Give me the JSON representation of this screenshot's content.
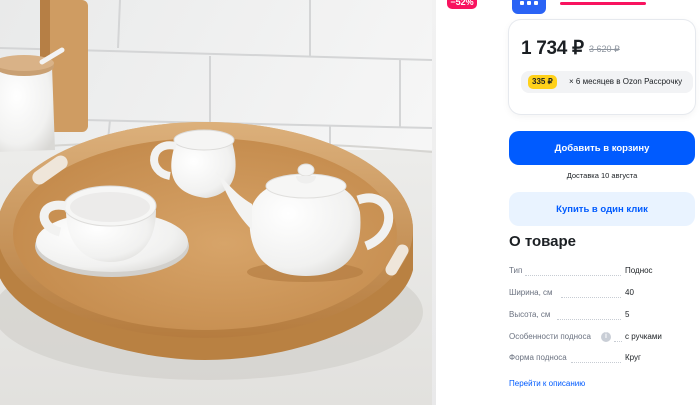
{
  "colors": {
    "accent": "#005bff",
    "accent_light": "#e9f3ff",
    "sale": "#f8135f",
    "installment": "#ffd11a"
  },
  "photo": {
    "alt": "Bamboo tray with white teapot, cup and creamer",
    "icon": "product-photo"
  },
  "badge": {
    "discount": "−52%"
  },
  "price_block": {
    "price": "1 734 ₽",
    "old_price": "3 620 ₽",
    "installment_amount": "335 ₽",
    "installment_text": "× 6 месяцев в Ozon Рассрочку"
  },
  "actions": {
    "add_to_cart": "Добавить в корзину",
    "delivery": "Доставка 10 августа",
    "buy_one_click": "Купить в один клик"
  },
  "about": {
    "title": "О товаре",
    "specs": [
      {
        "label": "Тип",
        "value": "Поднос"
      },
      {
        "label": "Ширина, см",
        "value": "40"
      },
      {
        "label": "Высота, см",
        "value": "5"
      },
      {
        "label": "Особенности подноса",
        "value": "с ручками"
      },
      {
        "label": "Форма подноса",
        "value": "Круг"
      }
    ],
    "link": "Перейти к описанию"
  }
}
